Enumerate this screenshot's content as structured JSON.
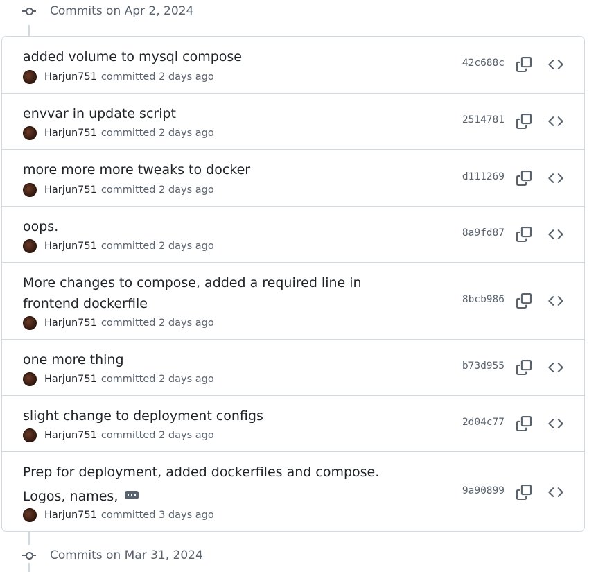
{
  "groups": [
    {
      "title": "Commits on Apr 2, 2024"
    },
    {
      "title": "Commits on Mar 31, 2024"
    }
  ],
  "icons": {
    "commit": "git-commit-icon",
    "copy": "copy-icon",
    "code": "code-icon",
    "more": "ellipsis-icon"
  },
  "commits": [
    {
      "line1": "added volume to mysql compose",
      "line2": "",
      "author": "Harjun751",
      "action": "committed",
      "time": "2 days ago",
      "sha": "42c688c"
    },
    {
      "line1": "envvar in update script",
      "line2": "",
      "author": "Harjun751",
      "action": "committed",
      "time": "2 days ago",
      "sha": "2514781"
    },
    {
      "line1": "more more more tweaks to docker",
      "line2": "",
      "author": "Harjun751",
      "action": "committed",
      "time": "2 days ago",
      "sha": "d111269"
    },
    {
      "line1": "oops.",
      "line2": "",
      "author": "Harjun751",
      "action": "committed",
      "time": "2 days ago",
      "sha": "8a9fd87"
    },
    {
      "line1": "More changes to compose, added a required line in",
      "line2": "frontend dockerfile",
      "author": "Harjun751",
      "action": "committed",
      "time": "2 days ago",
      "sha": "8bcb986"
    },
    {
      "line1": "one more thing",
      "line2": "",
      "author": "Harjun751",
      "action": "committed",
      "time": "2 days ago",
      "sha": "b73d955"
    },
    {
      "line1": "slight change to deployment configs",
      "line2": "",
      "author": "Harjun751",
      "action": "committed",
      "time": "2 days ago",
      "sha": "2d04c77"
    },
    {
      "line1": "Prep for deployment, added dockerfiles and compose.",
      "line2": "Logos, names,",
      "author": "Harjun751",
      "action": "committed",
      "time": "3 days ago",
      "sha": "9a90899"
    }
  ]
}
